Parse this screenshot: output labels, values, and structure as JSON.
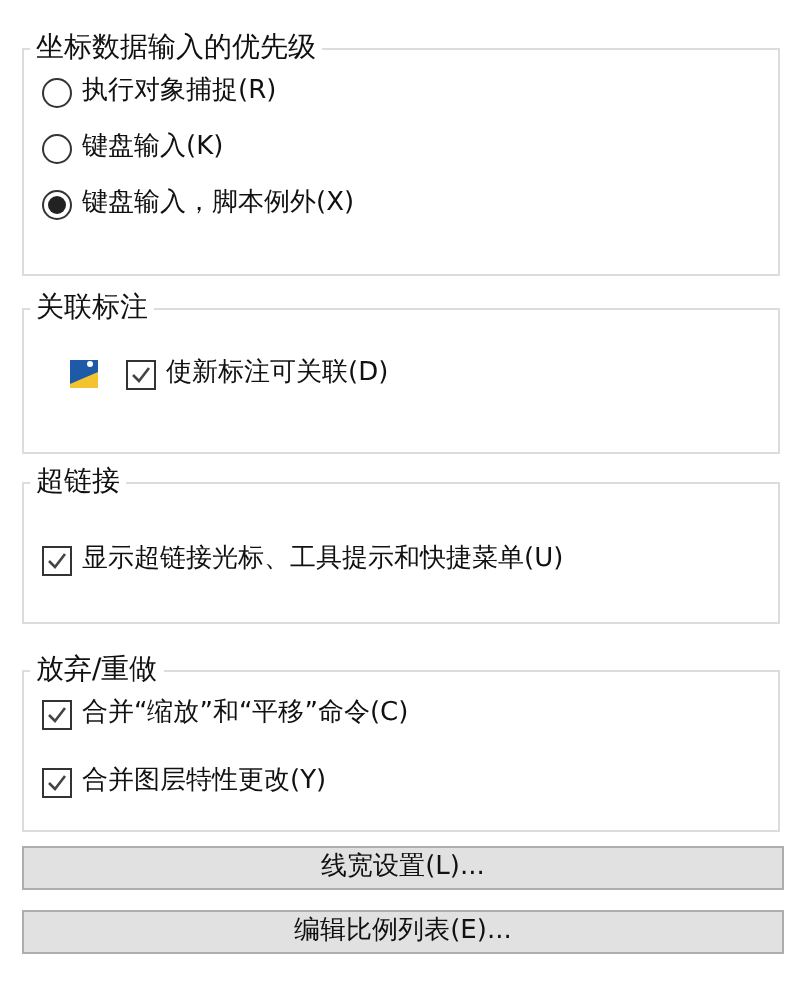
{
  "groups": [
    {
      "title": "坐标数据输入的优先级",
      "items": [
        {
          "kind": "radio",
          "label": "执行对象捕捉(R)",
          "selected": false
        },
        {
          "kind": "radio",
          "label": "键盘输入(K)",
          "selected": false
        },
        {
          "kind": "radio",
          "label": "键盘输入，脚本例外(X)",
          "selected": true
        }
      ]
    },
    {
      "title": "关联标注",
      "items": [
        {
          "kind": "checkbox",
          "label": "使新标注可关联(D)",
          "checked": true,
          "icon": true
        }
      ]
    },
    {
      "title": "超链接",
      "items": [
        {
          "kind": "checkbox",
          "label": "显示超链接光标、工具提示和快捷菜单(U)",
          "checked": true
        }
      ]
    },
    {
      "title": "放弃/重做",
      "items": [
        {
          "kind": "checkbox",
          "label": "合并“缩放”和“平移”命令(C)",
          "checked": true
        },
        {
          "kind": "checkbox",
          "label": "合并图层特性更改(Y)",
          "checked": true
        }
      ]
    }
  ],
  "buttons": [
    "线宽设置(L)...",
    "编辑比例列表(E)..."
  ]
}
